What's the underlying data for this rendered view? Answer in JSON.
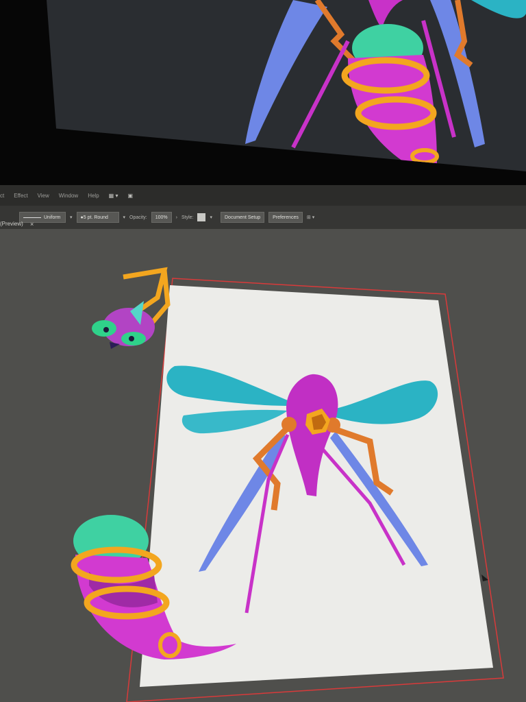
{
  "menu": {
    "items": [
      "ct",
      "Effect",
      "View",
      "Window",
      "Help"
    ]
  },
  "control_bar": {
    "stroke_profile": "Uniform",
    "brush_label": "5 pt. Round",
    "opacity_label": "Opacity:",
    "opacity_value": "100%",
    "style_label": "Style:",
    "document_setup_label": "Document Setup",
    "preferences_label": "Preferences"
  },
  "document_tab": {
    "label": "(Preview)",
    "close": "×"
  },
  "colors": {
    "artboard": "#ecece9",
    "canvas_bg": "#4f4f4c",
    "artboard_border": "#d93a3a",
    "wing_teal": "#2bb3c4",
    "wing_blue": "#6e87e6",
    "body_magenta": "#c832c8",
    "leg_orange": "#e07a2c",
    "ring_gold": "#f3a61f",
    "egg_mint": "#3fd1a2"
  },
  "icons": [
    "arrange-icon",
    "screen-mode-icon",
    "stroke-swatch-icon",
    "brush-swatch-icon",
    "style-swatch-icon",
    "align-icon",
    "cursor-icon"
  ]
}
